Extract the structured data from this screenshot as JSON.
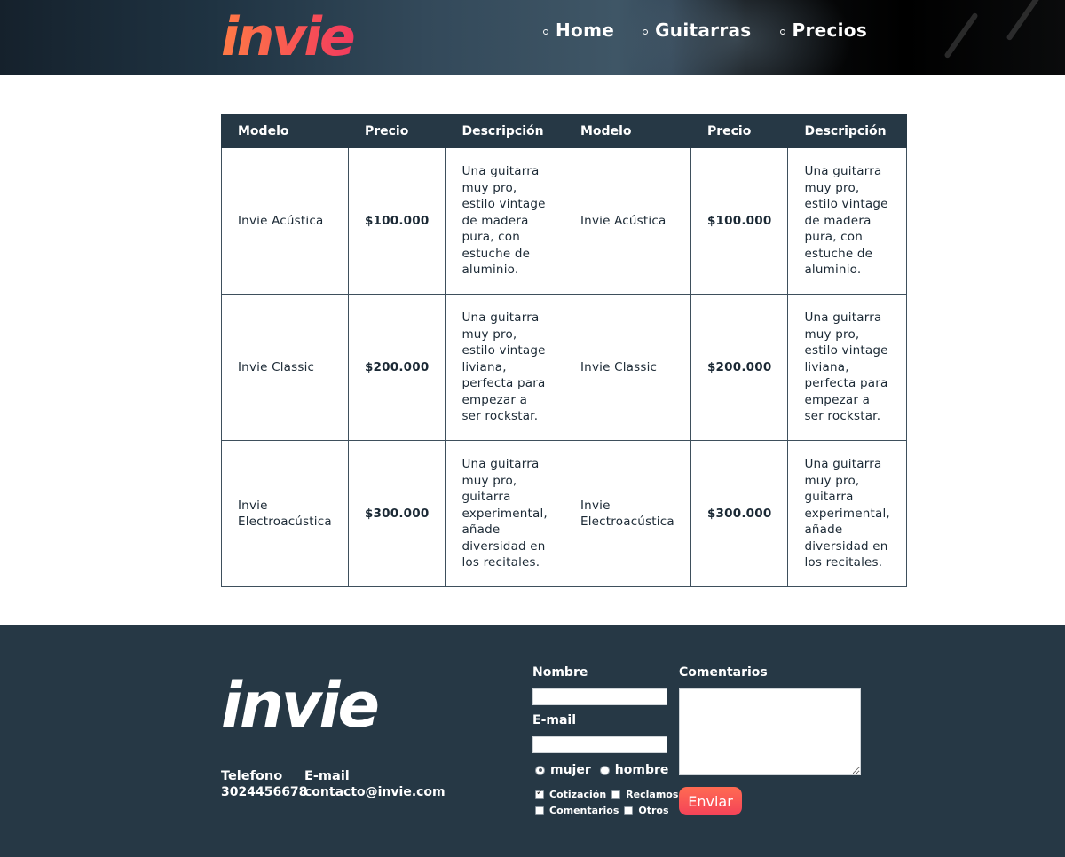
{
  "brand": {
    "logo_text": "invie"
  },
  "nav": {
    "items": [
      {
        "label": "Home"
      },
      {
        "label": "Guitarras"
      },
      {
        "label": "Precios"
      }
    ]
  },
  "table": {
    "headers": [
      "Modelo",
      "Precio",
      "Descripción",
      "Modelo",
      "Precio",
      "Descripción"
    ],
    "rows": [
      [
        "Invie Acústica",
        "$100.000",
        "Una guitarra muy pro, estilo vintage de madera pura, con estuche de aluminio.",
        "Invie Acústica",
        "$100.000",
        "Una guitarra muy pro, estilo vintage de madera pura, con estuche de aluminio."
      ],
      [
        "Invie Classic",
        "$200.000",
        "Una guitarra muy pro, estilo vintage liviana, perfecta para empezar a ser rockstar.",
        "Invie Classic",
        "$200.000",
        "Una guitarra muy pro, estilo vintage liviana, perfecta para empezar a ser rockstar."
      ],
      [
        "Invie Electroacústica",
        "$300.000",
        "Una guitarra muy pro, guitarra experimental, añade diversidad en los recitales.",
        "Invie Electroacústica",
        "$300.000",
        "Una guitarra muy pro, guitarra experimental, añade diversidad en los recitales."
      ]
    ]
  },
  "footer": {
    "phone_label": "Telefono",
    "phone_value": "3024456678",
    "email_label": "E-mail",
    "email_value": "contacto@invie.com",
    "form": {
      "name_label": "Nombre",
      "email_label": "E-mail",
      "comments_label": "Comentarios",
      "radio_mujer": "mujer",
      "radio_hombre": "hombre",
      "check_cotizacion": "Cotización",
      "check_reclamos": "Reclamos",
      "check_comentarios": "Comentarios",
      "check_otros": "Otros",
      "submit_label": "Enviar"
    }
  },
  "colors": {
    "dark_navy": "#263845",
    "logo_gradient_start": "#ff7a45",
    "logo_gradient_end": "#f23a5e",
    "button_start": "#ff6b52",
    "button_end": "#f44358"
  }
}
